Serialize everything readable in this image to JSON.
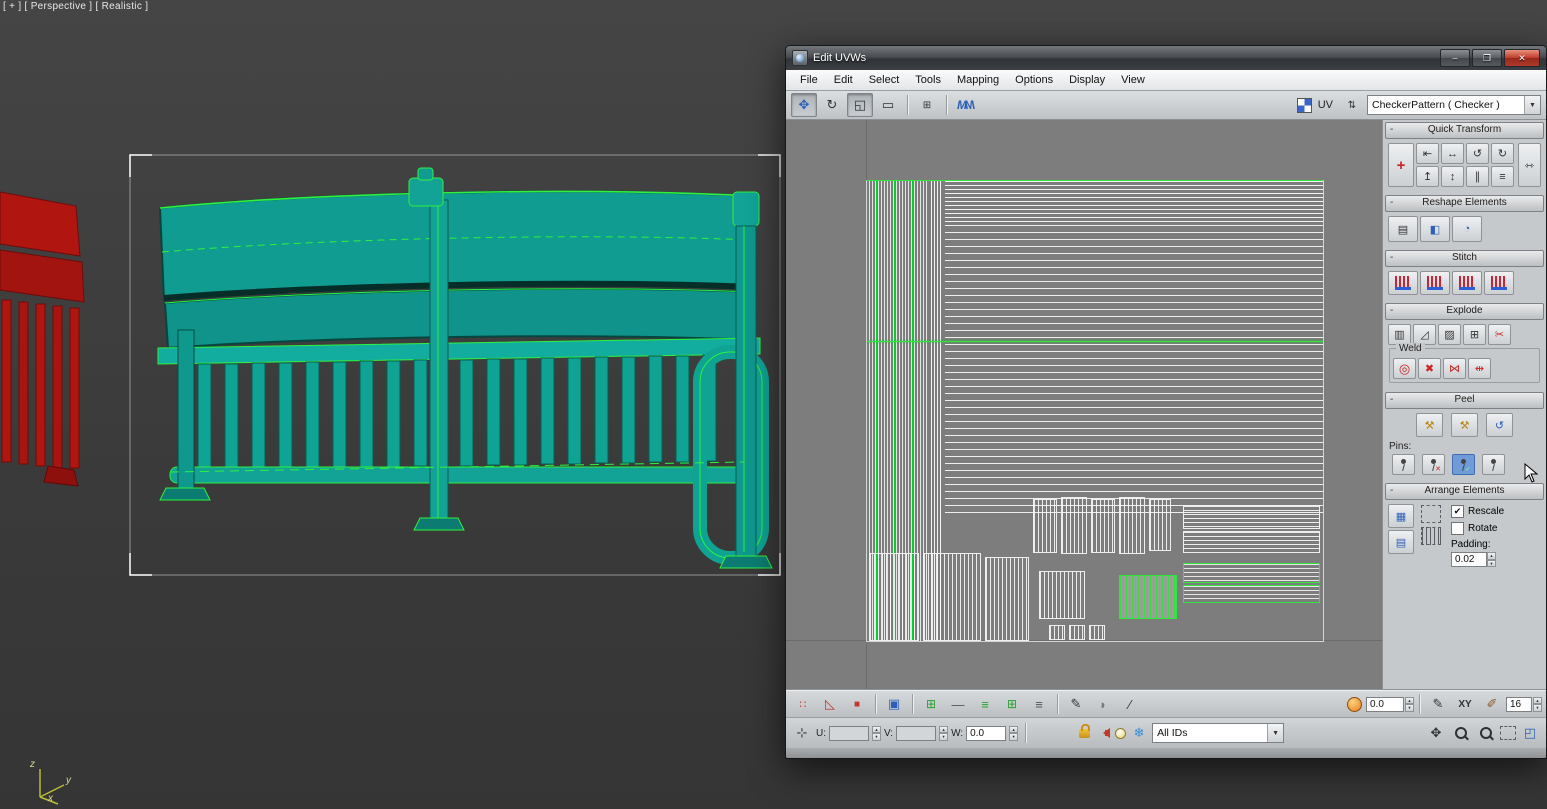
{
  "viewport": {
    "overlay": "[ + ] [ Perspective ] [ Realistic ]",
    "axis_x": "x",
    "axis_y": "y",
    "axis_z": "z"
  },
  "uvw": {
    "title": "Edit UVWs",
    "controls": {
      "minimize": "–",
      "maximize": "❐",
      "close": "✕"
    },
    "menus": [
      "File",
      "Edit",
      "Select",
      "Tools",
      "Mapping",
      "Options",
      "Display",
      "View"
    ],
    "toolbar": {
      "uv_label": "UV",
      "pattern": "CheckerPattern  ( Checker )"
    },
    "rollouts": {
      "collapse": "-",
      "quick_transform": "Quick Transform",
      "reshape_elements": "Reshape Elements",
      "stitch": "Stitch",
      "explode": "Explode",
      "weld": "Weld",
      "peel": "Peel",
      "pins": "Pins:",
      "arrange_elements": "Arrange Elements",
      "rescale": "Rescale",
      "rotate": "Rotate",
      "padding_label": "Padding:",
      "padding_value": "0.02"
    },
    "statusbar": {
      "falloff_value": "0.0",
      "xy_label": "XY",
      "brush_size": "16",
      "u_label": "U:",
      "u_value": "",
      "v_label": "V:",
      "v_value": "",
      "w_label": "W:",
      "w_value": "0.0",
      "ids": "All IDs"
    }
  }
}
